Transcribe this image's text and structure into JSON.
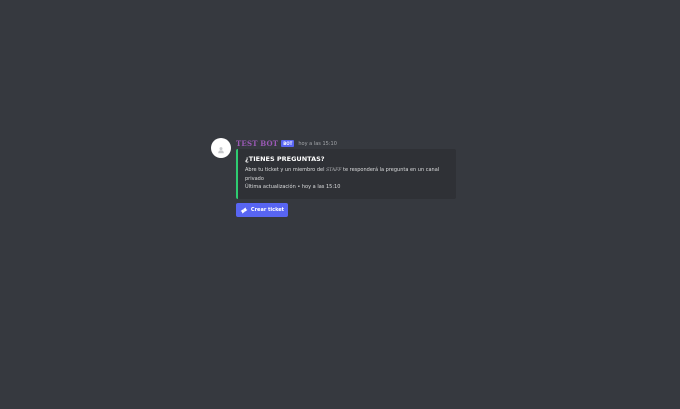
{
  "message": {
    "username": "TEST BOT",
    "bot_tag": "BOT",
    "timestamp": "hoy a las 15:10",
    "avatar_icon": "default-avatar-icon",
    "username_color": "#9b59b6"
  },
  "embed": {
    "title": "¿TIENES PREGUNTAS?",
    "description_before": "Abre tu ticket y un miembro del",
    "description_staff": "STAFF",
    "description_after": "te responderá la pregunta en un canal privado",
    "footer": "Última actualización • hoy a las 15:10",
    "accent_color": "#2ecc71"
  },
  "button": {
    "label": "Crear ticket",
    "icon": "ticket-icon",
    "color": "#5865f2"
  }
}
